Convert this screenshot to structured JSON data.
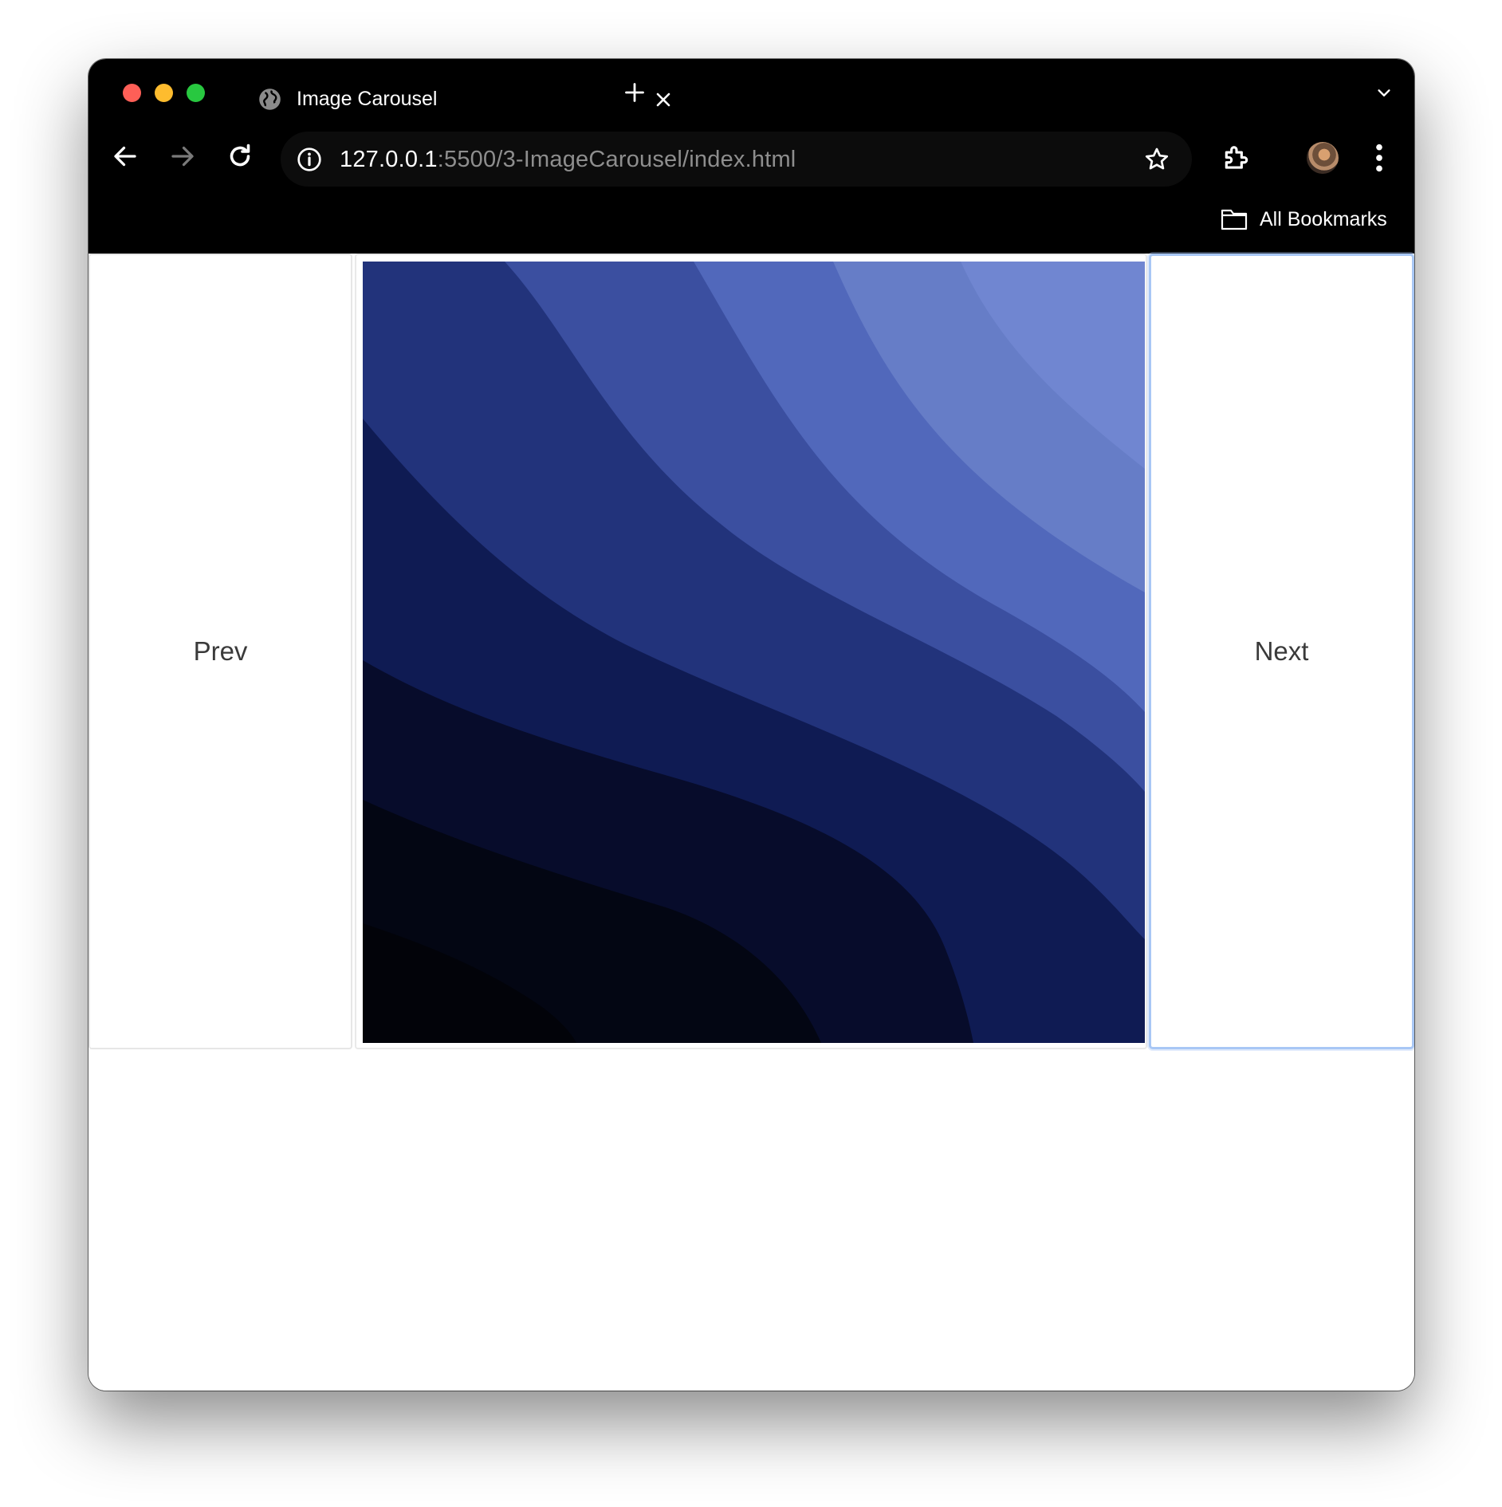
{
  "browser": {
    "tab": {
      "title": "Image Carousel"
    },
    "address_bar": {
      "host": "127.0.0.1",
      "path": ":5500/3-ImageCarousel/index.html"
    },
    "bookmarks_bar": {
      "folder_label": "All Bookmarks"
    }
  },
  "page": {
    "carousel": {
      "prev_label": "Prev",
      "next_label": "Next",
      "image": {
        "description_icon": "abstract-blue-waves-image",
        "colors": [
          "#030613",
          "#070c2b",
          "#0f1b53",
          "#22337b",
          "#3b4fa0",
          "#5168bb",
          "#667dc7",
          "#7086d1"
        ]
      }
    }
  }
}
